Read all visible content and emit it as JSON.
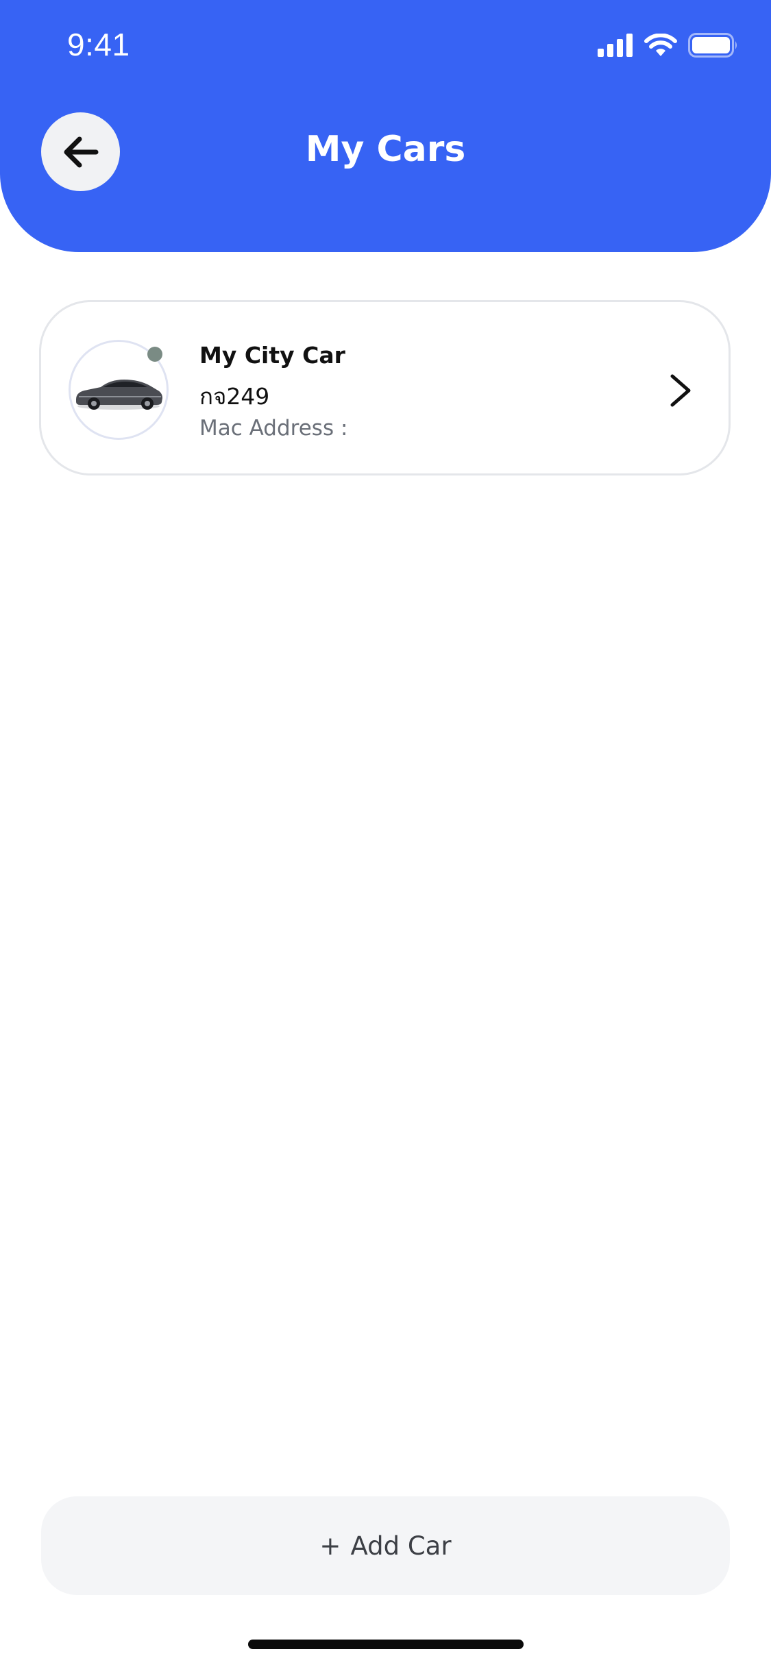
{
  "status_bar": {
    "time": "9:41",
    "icons": [
      "signal-icon",
      "wifi-icon",
      "battery-icon"
    ]
  },
  "header": {
    "title": "My Cars",
    "back_icon": "arrow-left-icon",
    "color": "#3763F4"
  },
  "cars": [
    {
      "name": "My City Car",
      "plate": "กจ249",
      "mac_label": "Mac Address :",
      "status_color": "#7A8B84",
      "image": "car-photo-icon",
      "chevron_icon": "chevron-right-icon"
    }
  ],
  "footer": {
    "add_icon": "+",
    "add_label": "Add Car"
  }
}
